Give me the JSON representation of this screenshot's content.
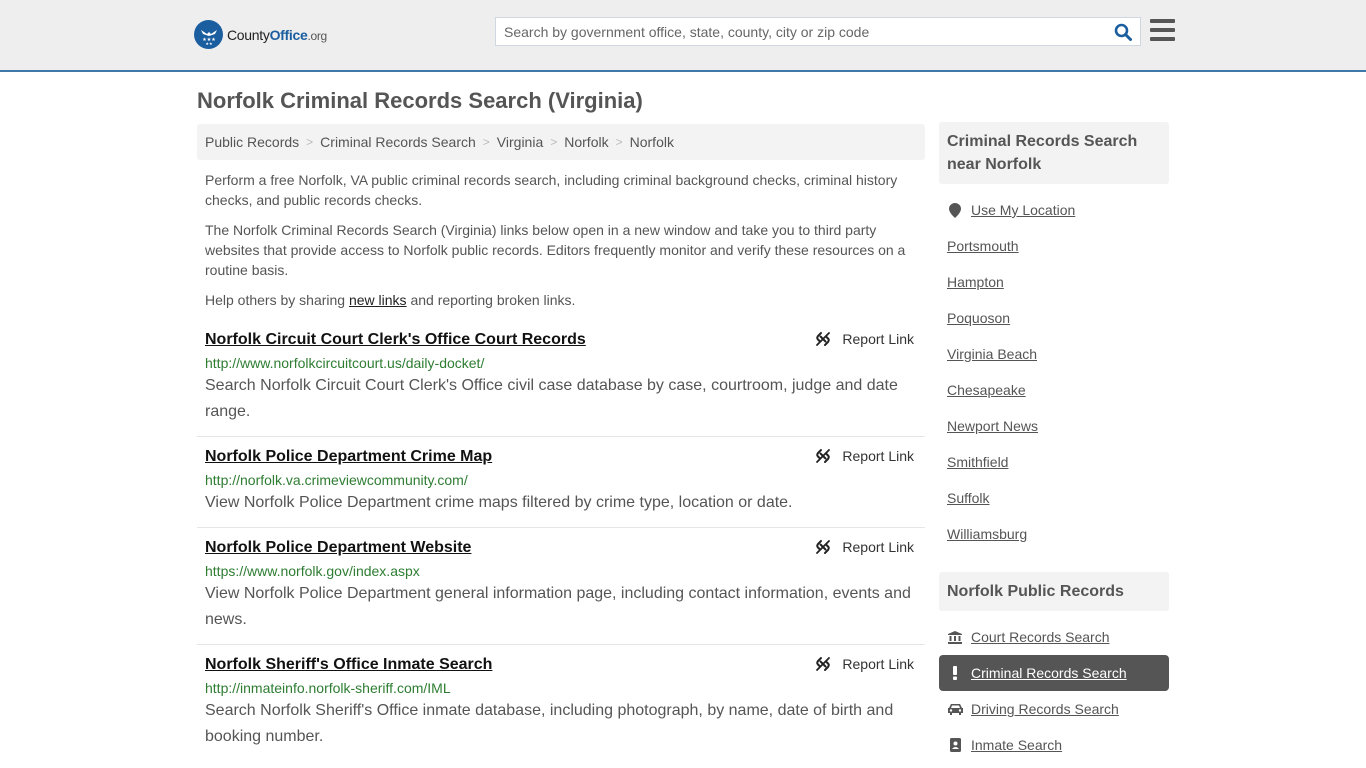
{
  "header": {
    "logo": {
      "county": "County",
      "office": "Office",
      "org": ".org"
    },
    "search": {
      "placeholder": "Search by government office, state, county, city or zip code",
      "value": ""
    },
    "icons": {
      "search": "search-icon",
      "menu": "hamburger-menu-icon"
    },
    "accent_color": "#3d78a8",
    "brand_color": "#1b5ea0"
  },
  "page_title": "Norfolk Criminal Records Search (Virginia)",
  "breadcrumb": [
    "Public Records",
    "Criminal Records Search",
    "Virginia",
    "Norfolk",
    "Norfolk"
  ],
  "intro": {
    "p1": "Perform a free Norfolk, VA public criminal records search, including criminal background checks, criminal history checks, and public records checks.",
    "p2": "The Norfolk Criminal Records Search (Virginia) links below open in a new window and take you to third party websites that provide access to Norfolk public records. Editors frequently monitor and verify these resources on a routine basis.",
    "p3_before": "Help others by sharing ",
    "p3_link": "new links",
    "p3_after": " and reporting broken links."
  },
  "report_label": "Report Link",
  "results": [
    {
      "title": "Norfolk Circuit Court Clerk's Office Court Records",
      "url": "http://www.norfolkcircuitcourt.us/daily-docket/",
      "description": "Search Norfolk Circuit Court Clerk's Office civil case database by case, courtroom, judge and date range."
    },
    {
      "title": "Norfolk Police Department Crime Map",
      "url": "http://norfolk.va.crimeviewcommunity.com/",
      "description": "View Norfolk Police Department crime maps filtered by crime type, location or date."
    },
    {
      "title": "Norfolk Police Department Website",
      "url": "https://www.norfolk.gov/index.aspx",
      "description": "View Norfolk Police Department general information page, including contact information, events and news."
    },
    {
      "title": "Norfolk Sheriff's Office Inmate Search",
      "url": "http://inmateinfo.norfolk-sheriff.com/IML",
      "description": "Search Norfolk Sheriff's Office inmate database, including photograph, by name, date of birth and booking number."
    }
  ],
  "sidebar": {
    "nearby": {
      "heading": "Criminal Records Search near Norfolk",
      "use_location": "Use My Location",
      "cities": [
        "Portsmouth",
        "Hampton",
        "Poquoson",
        "Virginia Beach",
        "Chesapeake",
        "Newport News",
        "Smithfield",
        "Suffolk",
        "Williamsburg"
      ]
    },
    "public_records": {
      "heading": "Norfolk Public Records",
      "items": [
        {
          "label": "Court Records Search",
          "icon": "courthouse-icon",
          "active": false
        },
        {
          "label": "Criminal Records Search",
          "icon": "exclamation-icon",
          "active": true
        },
        {
          "label": "Driving Records Search",
          "icon": "car-icon",
          "active": false
        },
        {
          "label": "Inmate Search",
          "icon": "id-badge-icon",
          "active": false
        }
      ]
    }
  }
}
